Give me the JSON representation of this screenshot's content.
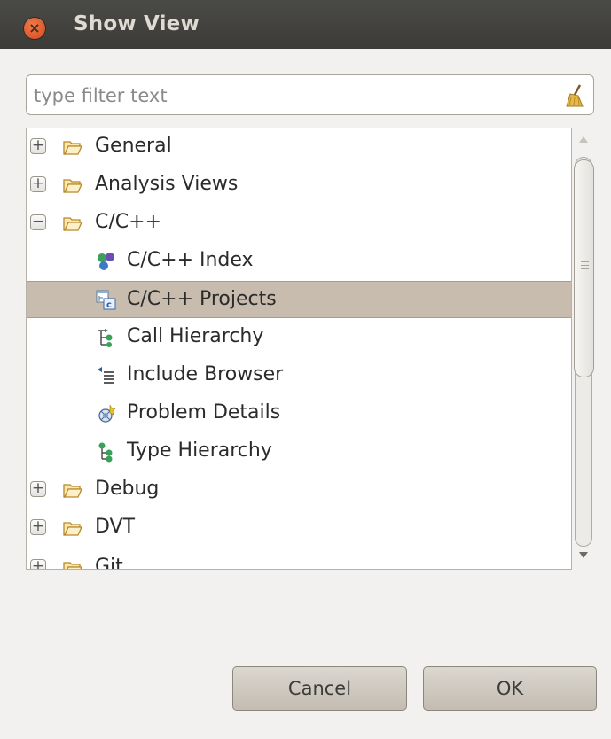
{
  "window": {
    "title": "Show View"
  },
  "filter": {
    "placeholder": "type filter text",
    "value": "",
    "clear_icon": "broom-icon"
  },
  "tree": {
    "items": [
      {
        "label": "General",
        "type": "folder",
        "expanded": false
      },
      {
        "label": "Analysis Views",
        "type": "folder",
        "expanded": false
      },
      {
        "label": "C/C++",
        "type": "folder",
        "expanded": true
      },
      {
        "label": "C/C++ Index",
        "type": "view",
        "icon": "index-icon"
      },
      {
        "label": "C/C++ Projects",
        "type": "view",
        "icon": "projects-icon",
        "selected": true
      },
      {
        "label": "Call Hierarchy",
        "type": "view",
        "icon": "call-hierarchy-icon"
      },
      {
        "label": "Include Browser",
        "type": "view",
        "icon": "include-browser-icon"
      },
      {
        "label": "Problem Details",
        "type": "view",
        "icon": "problem-details-icon"
      },
      {
        "label": "Type Hierarchy",
        "type": "view",
        "icon": "type-hierarchy-icon"
      },
      {
        "label": "Debug",
        "type": "folder",
        "expanded": false
      },
      {
        "label": "DVT",
        "type": "folder",
        "expanded": false
      },
      {
        "label": "Git",
        "type": "folder",
        "expanded": false
      }
    ],
    "toggle_plus": "+",
    "toggle_minus": "−"
  },
  "buttons": {
    "cancel": "Cancel",
    "ok": "OK"
  },
  "colors": {
    "titlebar": "#3c3b37",
    "selection": "#c8bcae",
    "dialog_bg": "#f2f1f0"
  }
}
